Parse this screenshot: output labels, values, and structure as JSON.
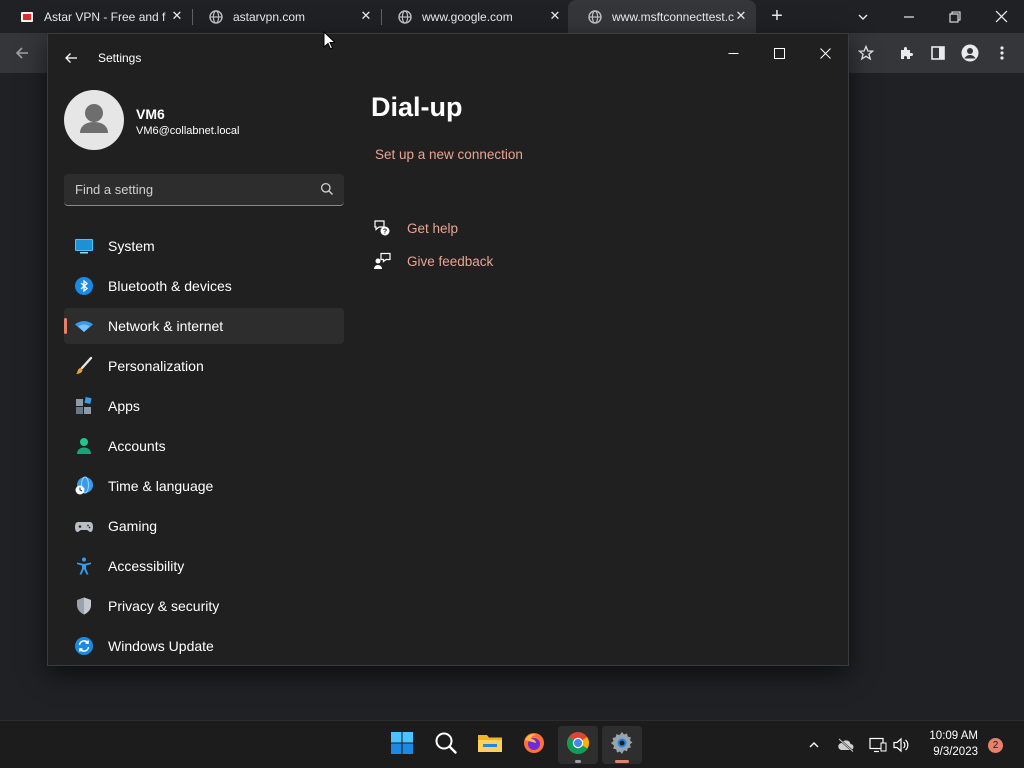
{
  "browser": {
    "tabs": [
      {
        "title": "Astar VPN - Free and fa",
        "favicon": "astar-vpn-favicon"
      },
      {
        "title": "astarvpn.com",
        "favicon": "globe-icon"
      },
      {
        "title": "www.google.com",
        "favicon": "globe-icon"
      },
      {
        "title": "www.msftconnecttest.c",
        "favicon": "globe-icon",
        "active": true
      }
    ],
    "new_tab_label": "+",
    "tab_close_glyph": "✕"
  },
  "settings": {
    "window_title": "Settings",
    "user": {
      "name": "VM6",
      "email": "VM6@collabnet.local"
    },
    "search": {
      "placeholder": "Find a setting"
    },
    "nav": [
      {
        "label": "System",
        "icon": "system-icon"
      },
      {
        "label": "Bluetooth & devices",
        "icon": "bluetooth-icon"
      },
      {
        "label": "Network & internet",
        "icon": "network-icon",
        "selected": true
      },
      {
        "label": "Personalization",
        "icon": "brush-icon"
      },
      {
        "label": "Apps",
        "icon": "apps-icon"
      },
      {
        "label": "Accounts",
        "icon": "accounts-icon"
      },
      {
        "label": "Time & language",
        "icon": "time-language-icon"
      },
      {
        "label": "Gaming",
        "icon": "gaming-icon"
      },
      {
        "label": "Accessibility",
        "icon": "accessibility-icon"
      },
      {
        "label": "Privacy & security",
        "icon": "shield-icon"
      },
      {
        "label": "Windows Update",
        "icon": "update-icon"
      }
    ],
    "page": {
      "title": "Dial-up",
      "setup_link": "Set up a new connection",
      "get_help": "Get help",
      "give_feedback": "Give feedback"
    }
  },
  "taskbar": {
    "apps": [
      "start-icon",
      "search-icon",
      "file-explorer-icon",
      "firefox-icon",
      "chrome-icon",
      "settings-icon"
    ],
    "clock": {
      "time": "10:09 AM",
      "date": "9/3/2023"
    },
    "notification_count": "2"
  },
  "colors": {
    "accent": "#e8806a",
    "link": "#e8a592",
    "window_bg": "#202020"
  }
}
